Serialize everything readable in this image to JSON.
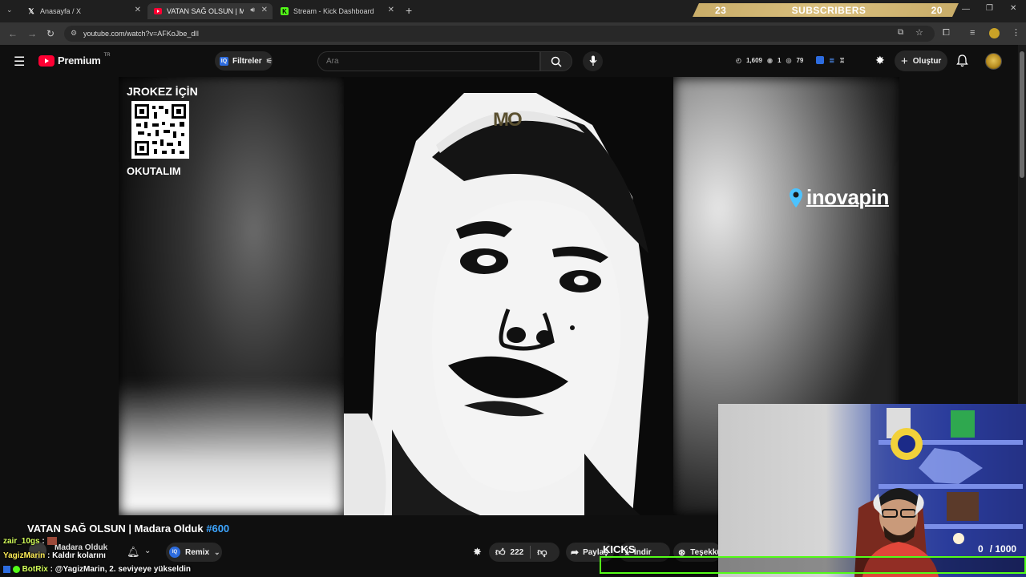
{
  "browser": {
    "tabs": [
      {
        "label": "Anasayfa / X",
        "icon": "x-logo-icon",
        "active": false
      },
      {
        "label": "VATAN SAĞ OLSUN | Madar",
        "icon": "youtube-logo-icon",
        "active": true
      },
      {
        "label": "Stream - Kick Dashboard",
        "icon": "kick-logo-icon",
        "active": false
      }
    ],
    "new_tab_symbol": "+",
    "url": "youtube.com/watch?v=AFKoJbe_dIl"
  },
  "overlay": {
    "subscriber_count_left": "23",
    "subscriber_label": "SUBSCRIBERS",
    "subscriber_count_right": "20",
    "kicks_label": "KICKS",
    "kicks_current": "0",
    "kicks_goal": "/ 1000"
  },
  "youtube": {
    "logo_text": "Premium",
    "region_badge": "TR",
    "filters_label": "Filtreler",
    "search_placeholder": "Ara",
    "stats": {
      "views": "1,609",
      "live": "1",
      "watching": "79"
    },
    "create_label": "Oluştur"
  },
  "video": {
    "qr_top_text": "JROKEZ İÇİN",
    "qr_bottom_text": "OKUTALIM",
    "brand_text": "inovapin",
    "watermark": "MO",
    "title": "VATAN SAĞ OLSUN | Madara Olduk",
    "episode_tag": "#600",
    "channel_name": "Madara Olduk",
    "remix_label": "Remix",
    "like_count": "222",
    "share_label": "Paylaş",
    "download_label": "İndir",
    "thanks_label": "Teşekkü"
  },
  "chat": [
    {
      "user": "zair_10gs",
      "sep": ":",
      "message": ""
    },
    {
      "user": "YagizMarin",
      "sep": ":",
      "message": "Kaldır kolarını"
    },
    {
      "user": "BotRix",
      "sep": ":",
      "message": "@YagizMarin, 2. seviyeye yükseldin"
    }
  ]
}
